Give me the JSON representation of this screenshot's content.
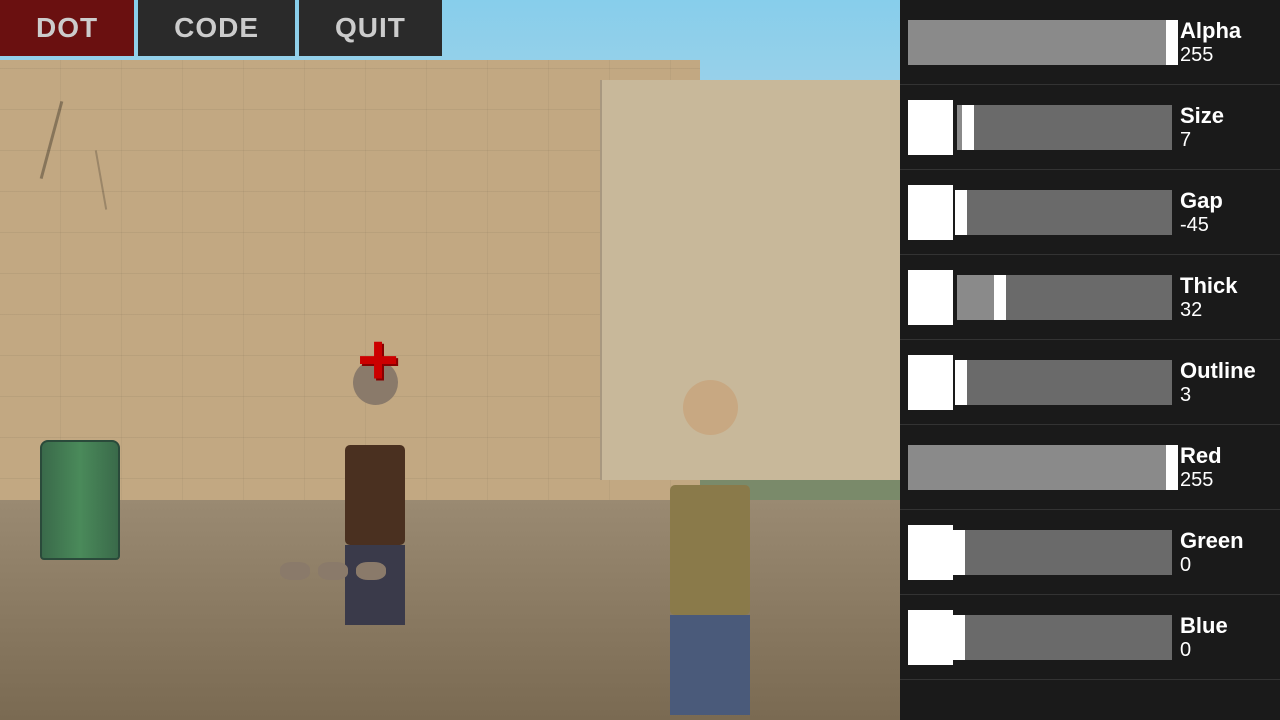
{
  "buttons": {
    "dot": "DOT",
    "code": "CODE",
    "quit": "QUIT"
  },
  "crosshair": "+",
  "sliders": [
    {
      "label": "Alpha",
      "value": "255",
      "fill_pct": 100,
      "has_left_white": true,
      "left_white": true
    },
    {
      "label": "Size",
      "value": "7",
      "fill_pct": 5,
      "has_left_white": true,
      "left_white": true
    },
    {
      "label": "Gap",
      "value": "-45",
      "fill_pct": 2,
      "has_left_white": true,
      "left_white": true
    },
    {
      "label": "Thick",
      "value": "32",
      "fill_pct": 20,
      "has_left_white": true,
      "left_white": true
    },
    {
      "label": "Outline",
      "value": "3",
      "fill_pct": 2,
      "has_left_white": true,
      "left_white": true
    },
    {
      "label": "Red",
      "value": "255",
      "fill_pct": 100,
      "has_left_white": false,
      "left_white": false
    },
    {
      "label": "Green",
      "value": "0",
      "fill_pct": 1,
      "has_left_white": true,
      "left_white": true
    },
    {
      "label": "Blue",
      "value": "0",
      "fill_pct": 1,
      "has_left_white": true,
      "left_white": true
    }
  ]
}
